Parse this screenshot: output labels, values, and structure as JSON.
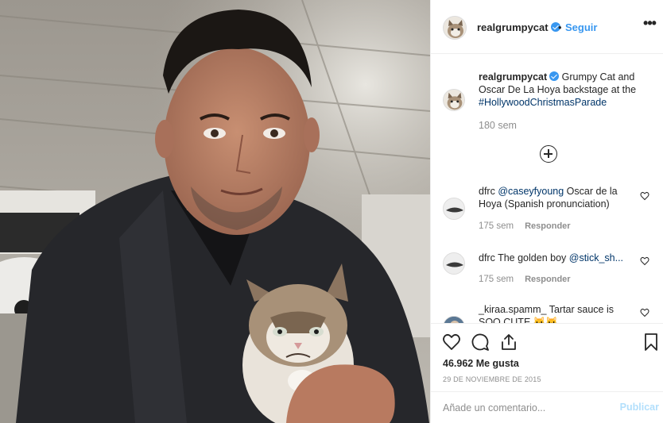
{
  "post": {
    "author": "realgrumpycat",
    "follow_label": "Seguir",
    "separator": "•",
    "more_label": "•••",
    "photo_description": "Man in dark jacket holding Grumpy Cat in a parking garage"
  },
  "caption": {
    "username": "realgrumpycat",
    "text": " Grumpy Cat and Oscar De La Hoya backstage at the ",
    "hashtag": "#HollywoodChristmasParade",
    "time": "180 sem"
  },
  "comments": [
    {
      "username": "dfrc",
      "mention": "@caseyfyoung",
      "text": " Oscar de la Hoya (Spanish pronunciation)",
      "time": "175 sem",
      "reply_label": "Responder"
    },
    {
      "username": "dfrc",
      "mention": "@stick_sh...",
      "text": "The golden boy ",
      "time": "175 sem",
      "reply_label": "Responder"
    },
    {
      "username": "_kiraa.spamm_",
      "text": " Tartar sauce is SOO CUTE 🐱🐱"
    }
  ],
  "actions": {
    "likes": "46.962 Me gusta",
    "date": "29 DE NOVIEMBRE DE 2015"
  },
  "add_comment": {
    "placeholder": "Añade un comentario...",
    "publish_label": "Publicar"
  },
  "colors": {
    "accent": "#3897f0",
    "link": "#003569",
    "muted": "#8e8e8e",
    "publish_disabled": "#b2dffc"
  }
}
